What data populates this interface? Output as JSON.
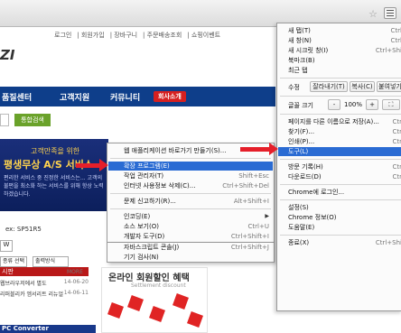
{
  "site": {
    "top_links": [
      "로그인",
      "회원가입",
      "장바구니",
      "주문배송조회",
      "쇼핑이벤트"
    ],
    "logo_text": "ZI",
    "nav": {
      "item1": "품질센터",
      "item2": "고객지원",
      "item3": "커뮤니티",
      "pill": "회사소개"
    },
    "search_button": "통합검색",
    "banner": {
      "line1": "고객만족을 위한",
      "line2": "평생무상 A/S 서비스",
      "line3": "편리한 서비스 중 진정한 서비스는... 고객의 불편을 최소화 하는 서비스를 위해 항상 노력하겠습니다."
    },
    "form": {
      "serial": "ex: SP51R5",
      "w_label": "W",
      "select1": "종류 선택",
      "select2": "출력방식"
    },
    "news": {
      "header": "시판",
      "more": "MORE",
      "items": [
        {
          "text": "웹브라우저에서 별도",
          "date": "14-06-20"
        },
        {
          "text": "리퍼블리카 엠서리트 리뉴얼",
          "date": "14-06-11"
        }
      ]
    },
    "promo": {
      "title": "온라인 회원할인 혜택",
      "subtitle": "Settlement discount"
    },
    "footer_title": "PC Converter"
  },
  "context_menu": {
    "items": [
      {
        "label": "웹 애플리케이션 바로가기 만들기(S)...",
        "shortcut": ""
      },
      {
        "label": "확장 프로그램(E)",
        "shortcut": "",
        "highlighted": true
      },
      {
        "label": "작업 관리자(T)",
        "shortcut": "Shift+Esc"
      },
      {
        "label": "인터넷 사용정보 삭제(C)...",
        "shortcut": "Ctrl+Shift+Del"
      },
      {
        "label": "문제 신고하기(R)...",
        "shortcut": "Alt+Shift+I"
      },
      {
        "label": "인코딩(E)",
        "shortcut": "",
        "submenu": true
      },
      {
        "label": "소스 보기(O)",
        "shortcut": "Ctrl+U"
      },
      {
        "label": "개발자 도구(D)",
        "shortcut": "Ctrl+Shift+I"
      },
      {
        "label": "자바스크립트 콘솔(J)",
        "shortcut": "Ctrl+Shift+J"
      },
      {
        "label": "기기 검사(N)",
        "shortcut": ""
      }
    ]
  },
  "main_menu": {
    "items_top": [
      {
        "label": "새 탭(T)",
        "shortcut": "Ctrl"
      },
      {
        "label": "새 창(N)",
        "shortcut": "Ctrl"
      },
      {
        "label": "새 시크릿 창(I)",
        "shortcut": "Ctrl+Shi"
      },
      {
        "label": "북마크(B)",
        "shortcut": ""
      },
      {
        "label": "최근 탭",
        "shortcut": ""
      }
    ],
    "edit_row": {
      "label": "수정",
      "cut": "잘라내기(T)",
      "copy": "복사(C)",
      "paste": "붙여넣기"
    },
    "zoom_row": {
      "label": "글꼴 크기",
      "minus": "-",
      "value": "100%",
      "plus": "+"
    },
    "items_mid": [
      {
        "label": "페이지를 다른 이름으로 저장(A)...",
        "shortcut": "Ctr"
      },
      {
        "label": "찾기(F)...",
        "shortcut": "Ctr"
      },
      {
        "label": "인쇄(P)...",
        "shortcut": "Ctr"
      },
      {
        "label": "도구(L)",
        "shortcut": "",
        "highlighted": true
      }
    ],
    "items_history": [
      {
        "label": "방문 기록(H)",
        "shortcut": "Ctr"
      },
      {
        "label": "다운로드(D)",
        "shortcut": "Ctr"
      }
    ],
    "signin": "Chrome에 로그인...",
    "items_settings": [
      {
        "label": "설정(S)",
        "shortcut": ""
      },
      {
        "label": "Chrome 정보(O)",
        "shortcut": ""
      },
      {
        "label": "도움말(E)",
        "shortcut": ""
      }
    ],
    "exit": {
      "label": "종료(X)",
      "shortcut": "Ctrl+Shi"
    }
  },
  "colors": {
    "highlight": "#2a6bd3",
    "arrow": "#e51f2a",
    "nav": "#0e3e8a"
  }
}
